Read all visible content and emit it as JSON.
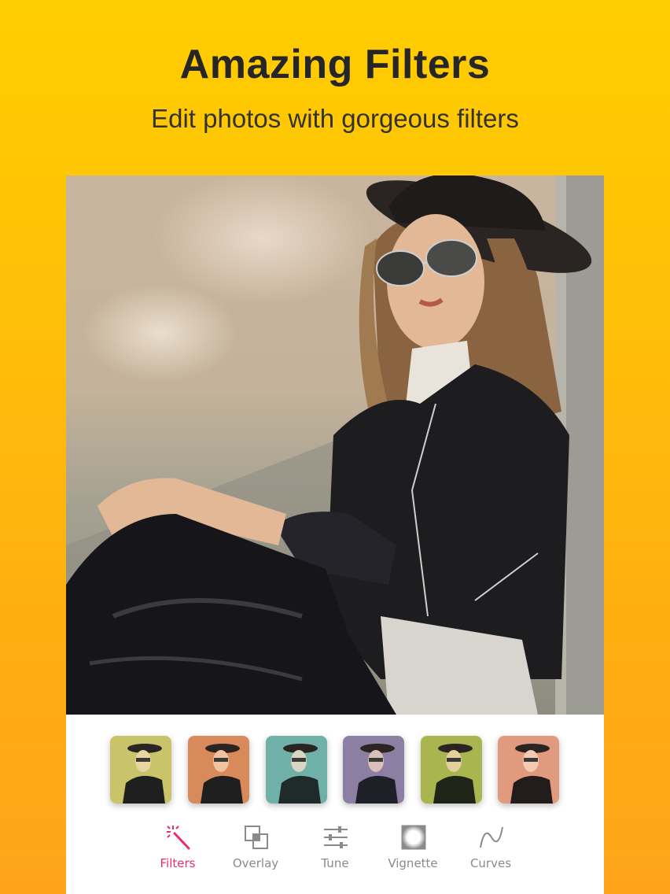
{
  "headline": "Amazing Filters",
  "subheadline": "Edit photos with gorgeous filters",
  "colors": {
    "background_top": "#FFCE00",
    "background_bottom": "#FFA41A",
    "active_tool": "#EE2B6D",
    "inactive_tool": "#8A8A8A"
  },
  "filter_thumbnails": [
    {
      "name": "filter-1",
      "tint": "#c9c36a"
    },
    {
      "name": "filter-2",
      "tint": "#d98a5a"
    },
    {
      "name": "filter-3",
      "tint": "#6fb0a8"
    },
    {
      "name": "filter-4",
      "tint": "#8c7fa3"
    },
    {
      "name": "filter-5",
      "tint": "#a9b54e"
    },
    {
      "name": "filter-6",
      "tint": "#e29a7e"
    }
  ],
  "toolbar": {
    "active": "Filters",
    "items": [
      {
        "label": "Filters",
        "icon": "magic-wand-icon"
      },
      {
        "label": "Overlay",
        "icon": "overlay-squares-icon"
      },
      {
        "label": "Tune",
        "icon": "sliders-icon"
      },
      {
        "label": "Vignette",
        "icon": "vignette-icon"
      },
      {
        "label": "Curves",
        "icon": "curve-icon"
      }
    ]
  }
}
